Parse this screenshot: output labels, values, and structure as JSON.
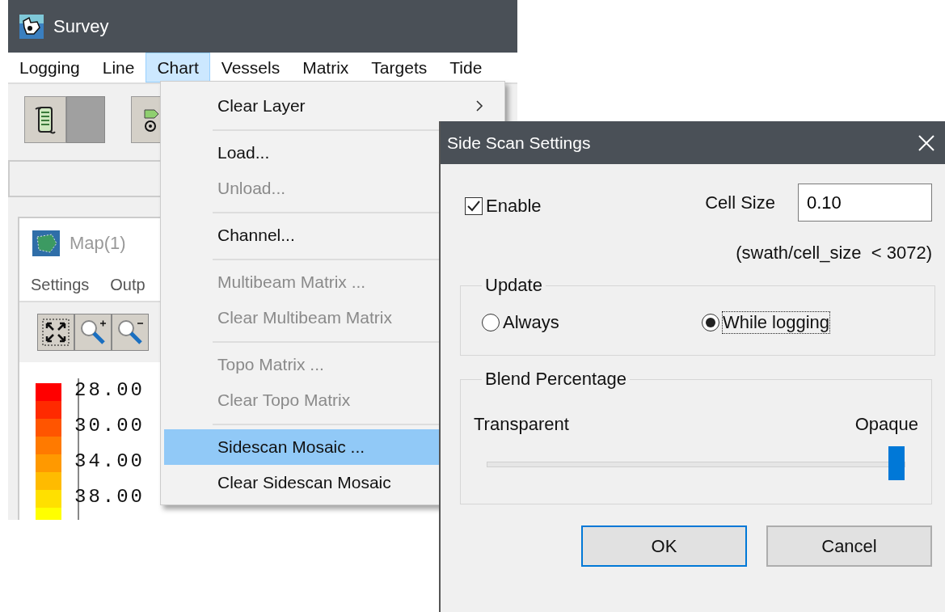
{
  "main_window": {
    "title": "Survey",
    "menu_bar": [
      {
        "label": "Logging",
        "selected": false
      },
      {
        "label": "Line",
        "selected": false
      },
      {
        "label": "Chart",
        "selected": true
      },
      {
        "label": "Vessels",
        "selected": false
      },
      {
        "label": "Matrix",
        "selected": false
      },
      {
        "label": "Targets",
        "selected": false
      },
      {
        "label": "Tide",
        "selected": false
      }
    ],
    "map_window": {
      "title": "Map(1)",
      "menu": [
        "Settings",
        "Outp"
      ],
      "legend_labels": [
        "28.00",
        "30.00",
        "34.00",
        "38.00"
      ]
    }
  },
  "chart_menu": {
    "groups": [
      [
        {
          "label": "Clear Layer",
          "disabled": false,
          "selected": false,
          "submenu": true
        }
      ],
      [
        {
          "label": "Load...",
          "disabled": false,
          "selected": false
        },
        {
          "label": "Unload...",
          "disabled": true,
          "selected": false
        }
      ],
      [
        {
          "label": "Channel...",
          "disabled": false,
          "selected": false
        }
      ],
      [
        {
          "label": "Multibeam Matrix ...",
          "disabled": true,
          "selected": false
        },
        {
          "label": "Clear Multibeam Matrix",
          "disabled": true,
          "selected": false
        }
      ],
      [
        {
          "label": "Topo Matrix ...",
          "disabled": true,
          "selected": false
        },
        {
          "label": "Clear Topo Matrix",
          "disabled": true,
          "selected": false
        }
      ],
      [
        {
          "label": "Sidescan Mosaic ...",
          "disabled": false,
          "selected": true
        },
        {
          "label": "Clear Sidescan Mosaic",
          "disabled": false,
          "selected": false
        }
      ]
    ]
  },
  "dialog": {
    "title": "Side Scan Settings",
    "enable": {
      "label": "Enable",
      "checked": true
    },
    "cell_size": {
      "label": "Cell Size",
      "value": "0.10"
    },
    "hint": "(swath/cell_size  < 3072)",
    "update": {
      "label": "Update",
      "options": [
        {
          "label": "Always",
          "selected": false,
          "focused": false
        },
        {
          "label": "While logging",
          "selected": true,
          "focused": true
        }
      ]
    },
    "blend": {
      "label": "Blend Percentage",
      "min_label": "Transparent",
      "max_label": "Opaque",
      "level": 0.98
    },
    "buttons": [
      {
        "label": "OK",
        "default": true
      },
      {
        "label": "Cancel",
        "default": false
      }
    ]
  }
}
